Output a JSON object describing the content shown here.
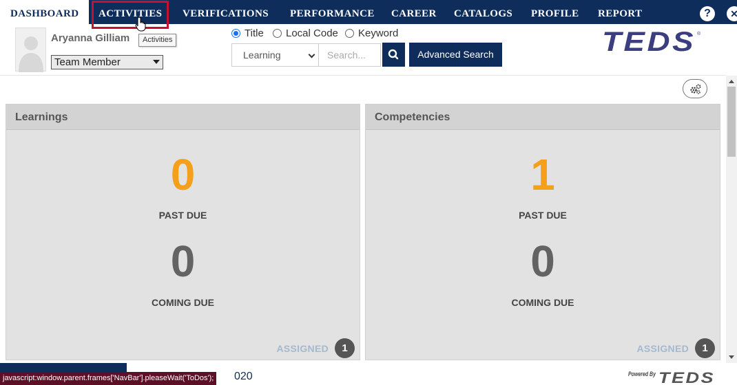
{
  "nav": {
    "items": [
      {
        "label": "DASHBOARD"
      },
      {
        "label": "ACTIVITIES"
      },
      {
        "label": "VERIFICATIONS"
      },
      {
        "label": "PERFORMANCE"
      },
      {
        "label": "CAREER"
      },
      {
        "label": "CATALOGS"
      },
      {
        "label": "PROFILE"
      },
      {
        "label": "REPORT"
      }
    ],
    "help_icon": "?",
    "close_icon": "✕",
    "tooltip": "Activities"
  },
  "user": {
    "name": "Aryanna Gilliam",
    "role": "Team Member"
  },
  "search": {
    "modes": [
      {
        "label": "Title",
        "checked": true
      },
      {
        "label": "Local Code",
        "checked": false
      },
      {
        "label": "Keyword",
        "checked": false
      }
    ],
    "category": "Learning",
    "placeholder": "Search...",
    "advanced_label": "Advanced Search"
  },
  "brand": {
    "logo_text": "TEDS",
    "powered_by": "Powered By",
    "navy": "#0f2d5a",
    "orange": "#f5a01a",
    "highlight": "#c8102e"
  },
  "cards": [
    {
      "title": "Learnings",
      "past_due_value": "0",
      "past_due_label": "PAST DUE",
      "coming_due_value": "0",
      "coming_due_label": "COMING DUE",
      "assigned_label": "ASSIGNED",
      "assigned_count": "1"
    },
    {
      "title": "Competencies",
      "past_due_value": "1",
      "past_due_label": "PAST DUE",
      "coming_due_value": "0",
      "coming_due_label": "COMING DUE",
      "assigned_label": "ASSIGNED",
      "assigned_count": "1"
    }
  ],
  "footer": {
    "year_fragment": "020",
    "status_text": "javascript:window.parent.frames['NavBar'].pleaseWait('ToDos');"
  }
}
